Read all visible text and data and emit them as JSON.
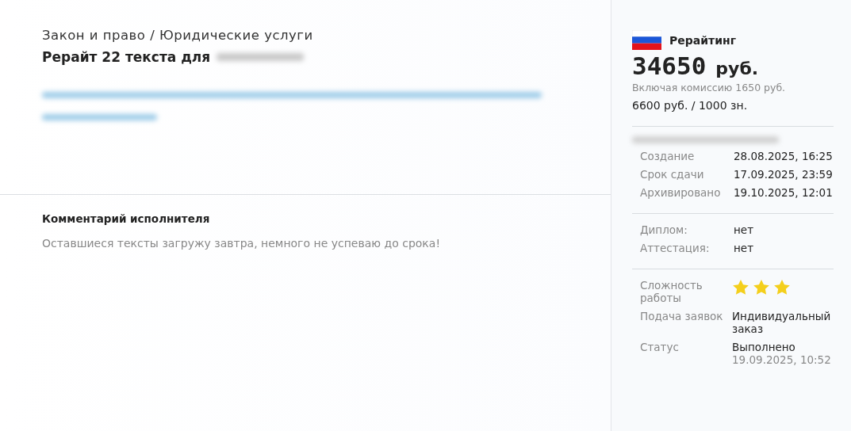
{
  "order": {
    "category": "Закон и право / Юридические услуги",
    "title": "Рерайт 22 текста для"
  },
  "comment": {
    "heading": "Комментарий исполнителя",
    "text": "Оставшиеся тексты загружу завтра, немного не успеваю до срока!"
  },
  "sidebar": {
    "type": "Рерайтинг",
    "price": "34650",
    "currency": "руб.",
    "commission": "Включая комиссию 1650 руб.",
    "rate": "6600 руб. / 1000 зн.",
    "dates": [
      {
        "label": "Создание",
        "value": "28.08.2025, 16:25"
      },
      {
        "label": "Срок сдачи",
        "value": "17.09.2025, 23:59"
      },
      {
        "label": "Архивировано",
        "value": "19.10.2025, 12:01"
      }
    ],
    "requirements": [
      {
        "label": "Диплом:",
        "value": "нет"
      },
      {
        "label": "Аттестация:",
        "value": "нет"
      }
    ],
    "difficulty": {
      "label": "Сложность работы",
      "stars": 3
    },
    "application": {
      "label": "Подача заявок",
      "value": "Индивидуальный заказ"
    },
    "status": {
      "label": "Статус",
      "value": "Выполнено",
      "date": "19.09.2025, 10:52"
    }
  }
}
